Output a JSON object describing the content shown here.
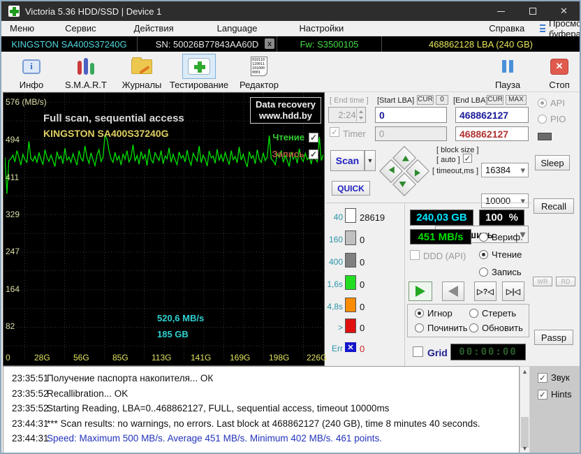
{
  "window": {
    "title": "Victoria 5.36 HDD/SSD | Device 1"
  },
  "menu": {
    "items": [
      {
        "label": "Меню"
      },
      {
        "label": "Сервис"
      },
      {
        "label": "Действия"
      },
      {
        "label": "Language"
      },
      {
        "label": "Настройки"
      },
      {
        "label": "Справка"
      }
    ],
    "buffer_view": "Просмотр буфера"
  },
  "drive_bar": {
    "model": "KINGSTON SA400S37240G",
    "serial": "SN: 50026B77843AA60D",
    "close_badge": "x",
    "firmware": "Fw: S3500105",
    "capacity": "468862128 LBA (240 GB)"
  },
  "toolbar": {
    "buttons": [
      {
        "label": "Инфо"
      },
      {
        "label": "S.M.A.R.T"
      },
      {
        "label": "Журналы"
      },
      {
        "label": "Тестирование"
      },
      {
        "label": "Редактор"
      }
    ],
    "editor_icon_text": "010110 110011 101000 0001",
    "pause": "Пауза",
    "stop": "Стоп"
  },
  "graph": {
    "title": "Full scan, sequential access",
    "subtitle": "KINGSTON SA400S37240G",
    "watermark_line1": "Data recovery",
    "watermark_line2": "www.hdd.by",
    "legend_read": "Чтение",
    "legend_write": "Запись",
    "overlay_speed": "520,6 MB/s",
    "overlay_position": "185 GB",
    "read_color": "#33cc33",
    "write_color": "#b06040"
  },
  "chart_data": {
    "type": "line",
    "title": "Full scan, sequential access",
    "y_unit": "(MB/s)",
    "y_tick_labels": [
      "576",
      "494",
      "411",
      "329",
      "247",
      "164",
      "82"
    ],
    "x_tick_labels": [
      "0",
      "28G",
      "56G",
      "85G",
      "113G",
      "141G",
      "169G",
      "198G",
      "226G"
    ],
    "ylim": [
      0,
      576
    ],
    "grid": true,
    "stats": {
      "max_mbs": 500,
      "avg_mbs": 451,
      "min_mbs": 402,
      "points": 461
    },
    "series": [
      {
        "name": "Чтение",
        "color": "#00e000",
        "values": [
          455,
          375,
          448,
          452,
          460,
          445,
          470,
          455,
          438,
          462,
          450,
          444,
          490,
          452,
          447,
          458,
          443,
          466,
          451,
          439,
          472,
          455,
          446,
          460,
          448,
          435,
          468,
          452,
          458,
          441,
          475,
          449,
          456,
          444,
          463,
          450,
          438,
          470,
          453,
          447,
          480,
          455,
          442,
          465,
          450,
          437,
          460,
          472,
          446,
          455,
          505,
          495,
          470,
          452,
          444,
          466,
          449,
          458,
          438,
          462,
          451,
          470,
          445,
          455,
          483,
          447,
          459,
          440,
          468,
          452,
          461,
          437,
          474,
          450,
          443,
          465,
          456,
          448,
          470,
          441,
          458,
          452,
          476,
          444,
          462,
          449,
          439,
          467,
          453,
          459,
          445,
          471,
          450,
          438,
          464,
          455,
          447,
          480,
          443,
          460,
          451,
          436,
          469,
          454,
          458,
          442,
          473,
          448,
          461,
          445,
          466,
          452,
          439,
          470,
          450,
          457,
          443,
          478,
          449,
          462,
          446,
          434,
          468,
          453,
          459,
          441,
          472,
          451,
          444,
          465,
          448,
          456,
          503,
          452,
          447,
          439,
          463,
          455,
          470,
          444,
          459,
          448,
          435,
          467,
          451,
          460,
          442,
          474,
          453,
          446,
          464,
          450,
          457,
          440,
          469,
          452,
          445,
          500,
          448,
          461
        ]
      }
    ]
  },
  "test_controls": {
    "end_time_label": "[ End time ]",
    "end_time_value": "2:24",
    "timer_label": "Timer",
    "timer_value": "0",
    "start_lba_label": "[Start LBA]",
    "start_lba_cur": "CUR",
    "start_lba_zero": "0",
    "start_lba_value": "0",
    "end_lba_label": "[End LBA]",
    "end_lba_cur": "CUR",
    "end_lba_max": "MAX",
    "end_lba_value": "468862127",
    "end_lba_value2": "468862127",
    "scan_label": "Scan",
    "quick_label": "QUICK",
    "block_size_label": "[ block size ]",
    "auto_label": "[ auto ]",
    "block_size_value": "16384",
    "timeout_label": "[ timeout,ms ]",
    "timeout_value": "10000",
    "finish_action": "Завершить"
  },
  "histogram": {
    "rows": [
      {
        "label": "40",
        "value": "28619",
        "color": "#ffffff"
      },
      {
        "label": "160",
        "value": "0",
        "color": "#c0c0c0"
      },
      {
        "label": "400",
        "value": "0",
        "color": "#808080"
      },
      {
        "label": "1,6s",
        "value": "0",
        "color": "#22dd22"
      },
      {
        "label": "4,8s",
        "value": "0",
        "color": "#ff8c00"
      },
      {
        "label": ">",
        "value": "0",
        "color": "#e01010"
      },
      {
        "label": "Err",
        "value": "0",
        "color": "#1515cc"
      }
    ]
  },
  "displays": {
    "size": "240,03 GB",
    "percent": "100",
    "percent_unit": "%",
    "speed": "451 MB/s",
    "timer_lcd": "00:00:00"
  },
  "mode": {
    "ddd": "DDD (API)",
    "verify": "Вериф.",
    "read": "Чтение",
    "write": "Запись"
  },
  "on_error": {
    "ignore": "Игнор",
    "erase": "Стереть",
    "repair": "Починить",
    "refresh": "Обновить"
  },
  "grid_control": {
    "label": "Grid"
  },
  "side": {
    "api": "API",
    "pio": "PIO",
    "sleep": "Sleep",
    "recall": "Recall",
    "wr": "WR",
    "rd": "RD",
    "passp": "Passp"
  },
  "log": {
    "lines": [
      {
        "time": "23:35:51",
        "text": "Получение паспорта накопителя... ОК"
      },
      {
        "time": "23:35:52",
        "text": "Recallibration... OK"
      },
      {
        "time": "23:35:52",
        "text": "Starting Reading, LBA=0..468862127, FULL, sequential access, timeout 10000ms"
      },
      {
        "time": "23:44:31",
        "text": "*** Scan results: no warnings, no errors. Last block at 468862127 (240 GB), time 8 minutes 40 seconds."
      },
      {
        "time": "23:44:31",
        "text": "Speed: Maximum 500 MB/s. Average 451 MB/s. Minimum 402 MB/s. 461 points."
      }
    ]
  },
  "options": {
    "sound": "Звук",
    "hints": "Hints"
  }
}
